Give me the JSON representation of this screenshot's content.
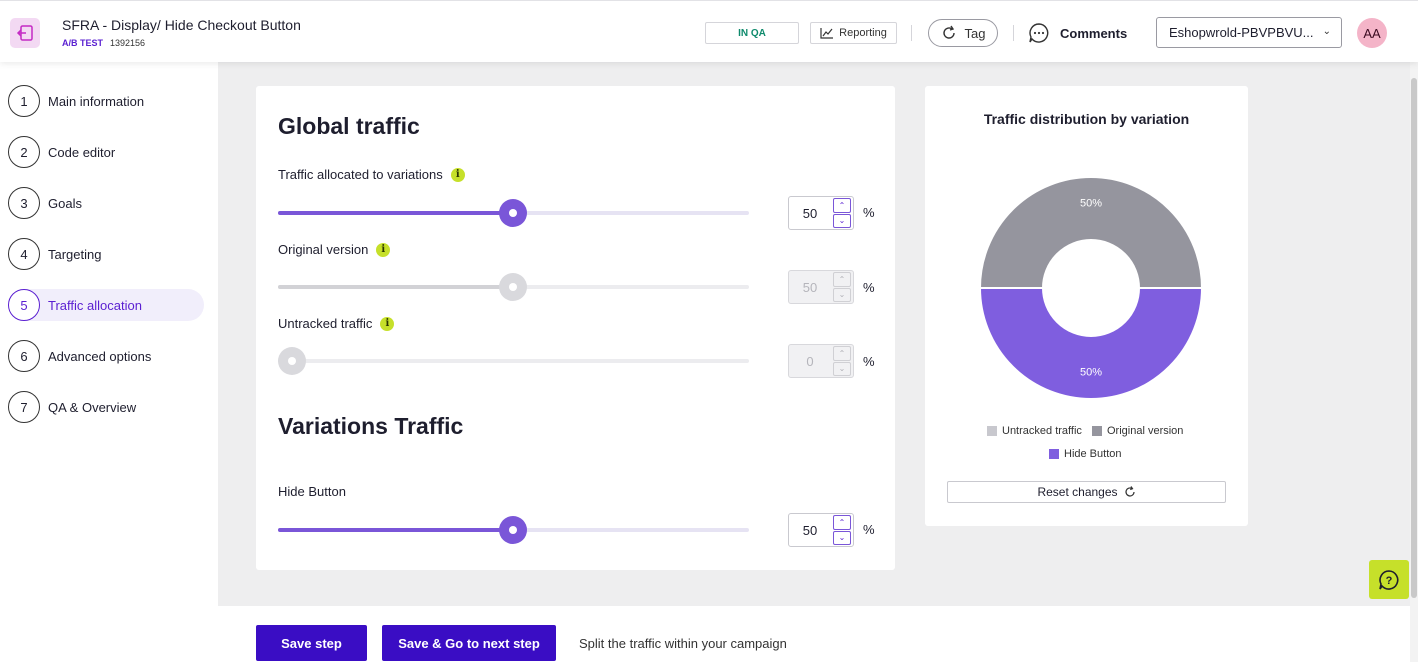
{
  "header": {
    "title": "SFRA - Display/ Hide Checkout Button",
    "type": "A/B TEST",
    "id": "1392156",
    "status": "IN QA",
    "reporting": "Reporting",
    "tag": "Tag",
    "comments": "Comments",
    "account": "Eshopwrold-PBVPBVU...",
    "avatar": "AA"
  },
  "sidebar": {
    "steps": [
      {
        "num": "1",
        "label": "Main information"
      },
      {
        "num": "2",
        "label": "Code editor"
      },
      {
        "num": "3",
        "label": "Goals"
      },
      {
        "num": "4",
        "label": "Targeting"
      },
      {
        "num": "5",
        "label": "Traffic allocation"
      },
      {
        "num": "6",
        "label": "Advanced options"
      },
      {
        "num": "7",
        "label": "QA & Overview"
      }
    ],
    "active_step": 5
  },
  "global": {
    "heading": "Global traffic",
    "allocated": {
      "label": "Traffic allocated to variations",
      "value": "50",
      "percent": 50
    },
    "original": {
      "label": "Original version",
      "value": "50",
      "percent": 50
    },
    "untracked": {
      "label": "Untracked traffic",
      "value": "0",
      "percent": 0
    },
    "unit": "%"
  },
  "variations": {
    "heading": "Variations Traffic",
    "items": [
      {
        "label": "Hide Button",
        "value": "50",
        "percent": 50
      }
    ]
  },
  "chart_data": {
    "type": "pie",
    "title": "Traffic distribution by variation",
    "slices": [
      {
        "name": "Untracked traffic",
        "value": 0,
        "label": "",
        "color": "#c8c8ce"
      },
      {
        "name": "Original version",
        "value": 50,
        "label": "50%",
        "color": "#95959e"
      },
      {
        "name": "Hide Button",
        "value": 50,
        "label": "50%",
        "color": "#7f5edf"
      }
    ],
    "donut": true,
    "legend_placement": "bottom"
  },
  "chart_card": {
    "reset_label": "Reset changes"
  },
  "footer": {
    "save_step": "Save step",
    "save_next": "Save & Go to next step",
    "hint": "Split the traffic within your campaign"
  }
}
